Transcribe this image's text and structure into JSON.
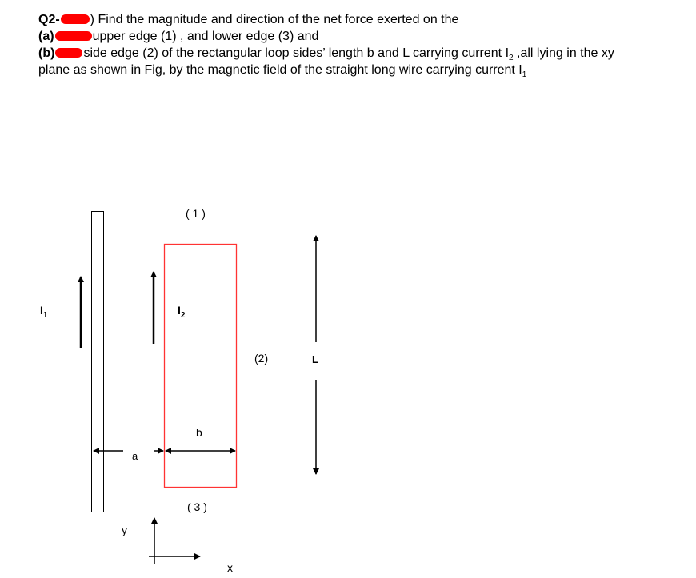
{
  "question": {
    "number": "Q2-",
    "intro": ") Find the magnitude and direction of the net force exerted on the",
    "part_a_label": "(a)",
    "part_a_text": "upper edge (1) , and lower edge (3) and",
    "part_b_label": "(b)",
    "part_b_text": "side edge (2) of the rectangular loop sides’ length b and L carrying current  I",
    "part_b_sub": "2",
    "part_b_text_end": " ,all lying in the xy",
    "line4_text": "plane as shown in Fig,  by the magnetic field of the straight long wire carrying current I",
    "line4_sub": "1",
    "redaction_color": "#ff0000"
  },
  "figure": {
    "wire_current_label": "I",
    "wire_current_sub": "1",
    "loop_current_label": "I",
    "loop_current_sub": "2",
    "edge_top_label": "( 1 )",
    "edge_side_label": "(2)",
    "edge_bottom_label": "( 3 )",
    "length_label": "L",
    "width_label": "b",
    "distance_label": "a",
    "axis_y_label": "y",
    "axis_x_label": "x",
    "loop_color": "#ff3333",
    "line_color": "#000000"
  }
}
